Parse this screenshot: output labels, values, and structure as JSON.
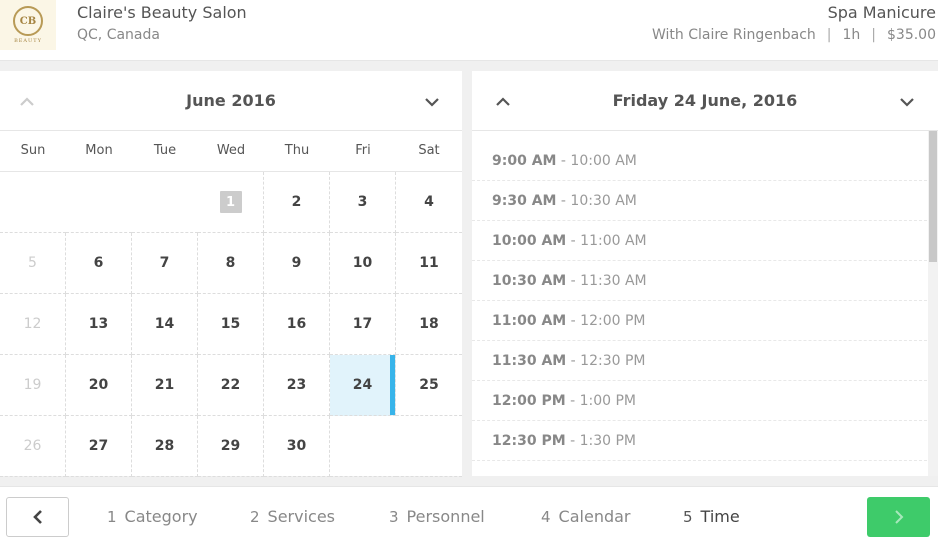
{
  "header": {
    "logo_text": "BEAUTY",
    "salon_name": "Claire's Beauty Salon",
    "location": "QC, Canada",
    "service_name": "Spa Manicure",
    "staff": "With Claire Ringenbach",
    "duration": "1h",
    "price": "$35.00"
  },
  "calendar": {
    "title": "June 2016",
    "days_of_week": [
      "Sun",
      "Mon",
      "Tue",
      "Wed",
      "Thu",
      "Fri",
      "Sat"
    ],
    "weeks": [
      [
        "",
        "",
        "",
        "1",
        "2",
        "3",
        "4"
      ],
      [
        "5",
        "6",
        "7",
        "8",
        "9",
        "10",
        "11"
      ],
      [
        "12",
        "13",
        "14",
        "15",
        "16",
        "17",
        "18"
      ],
      [
        "19",
        "20",
        "21",
        "22",
        "23",
        "24",
        "25"
      ],
      [
        "26",
        "27",
        "28",
        "29",
        "30",
        "",
        ""
      ]
    ],
    "today": "1",
    "selected": "24"
  },
  "times": {
    "title": "Friday 24 June, 2016",
    "slots": [
      {
        "start": "9:00 AM",
        "end": "10:00 AM"
      },
      {
        "start": "9:30 AM",
        "end": "10:30 AM"
      },
      {
        "start": "10:00 AM",
        "end": "11:00 AM"
      },
      {
        "start": "10:30 AM",
        "end": "11:30 AM"
      },
      {
        "start": "11:00 AM",
        "end": "12:00 PM"
      },
      {
        "start": "11:30 AM",
        "end": "12:30 PM"
      },
      {
        "start": "12:00 PM",
        "end": "1:00 PM"
      },
      {
        "start": "12:30 PM",
        "end": "1:30 PM"
      }
    ],
    "scroll_fraction": 0.38
  },
  "footer": {
    "steps": [
      {
        "num": "1",
        "label": "Category"
      },
      {
        "num": "2",
        "label": "Services"
      },
      {
        "num": "3",
        "label": "Personnel"
      },
      {
        "num": "4",
        "label": "Calendar"
      },
      {
        "num": "5",
        "label": "Time"
      }
    ],
    "active_step": "5"
  },
  "colors": {
    "accent": "#38b4ea",
    "next_button": "#3ecb6a",
    "selected_bg": "#e1f3fb"
  },
  "icons": {
    "prev_month": "chevron-up-icon",
    "next_month": "chevron-down-icon",
    "back": "chevron-left-icon",
    "next": "chevron-right-icon"
  }
}
